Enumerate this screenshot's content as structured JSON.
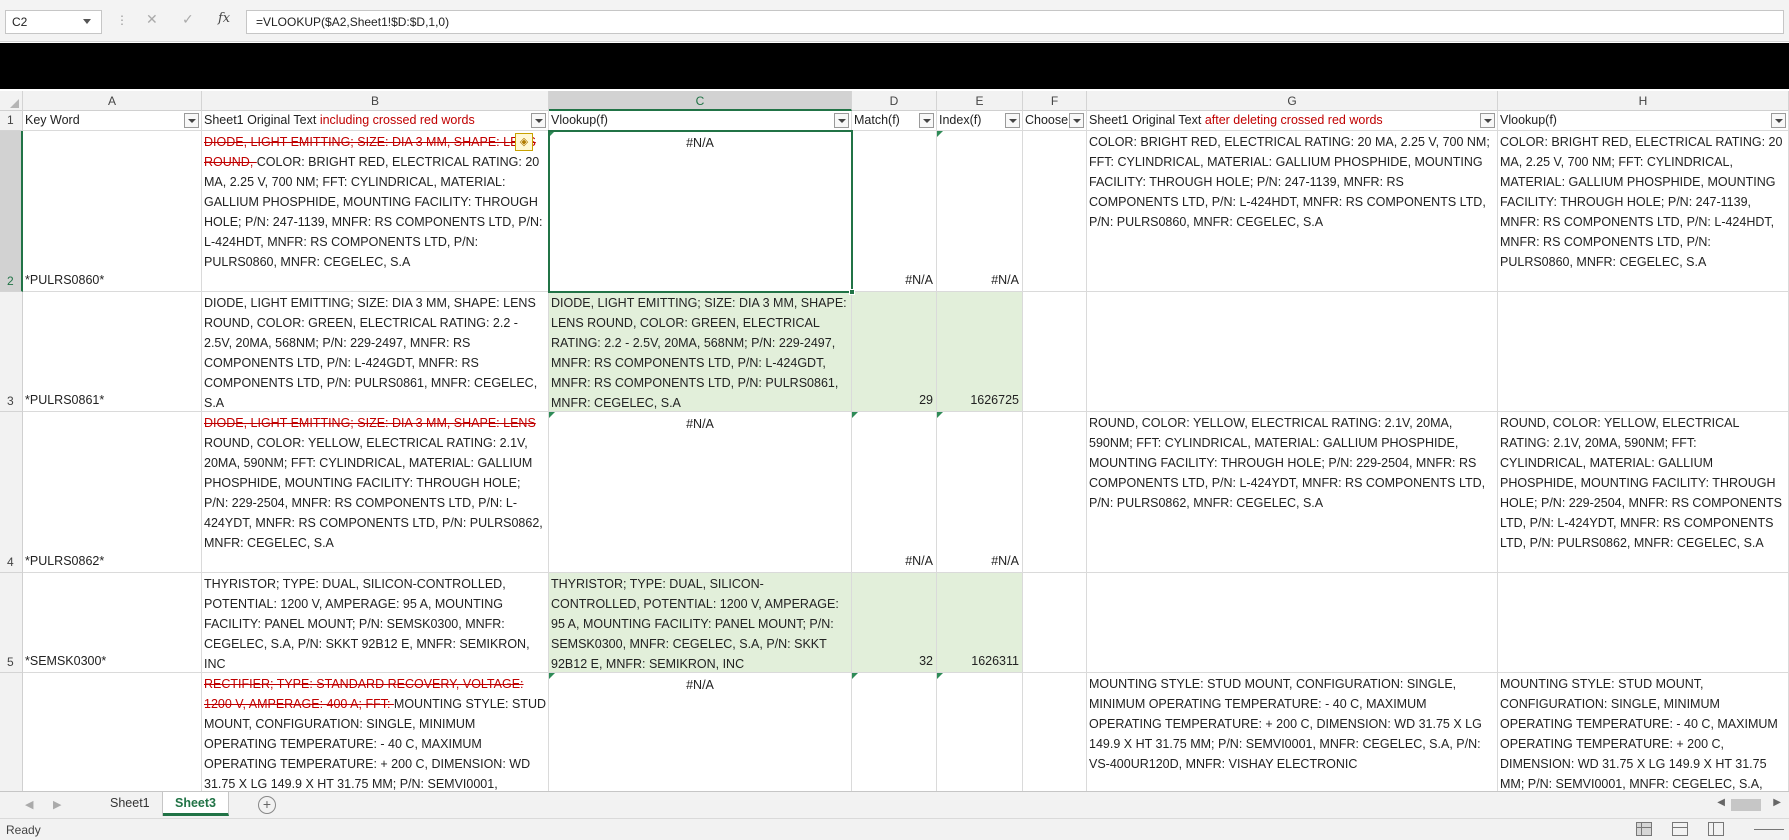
{
  "formula_bar": {
    "name_box": "C2",
    "cancel_glyph": "✕",
    "enter_glyph": "✓",
    "fx_label": "fx",
    "formula": "=VLOOKUP($A2,Sheet1!$D:$D,1,0)"
  },
  "columns": [
    "A",
    "B",
    "C",
    "D",
    "E",
    "F",
    "G",
    "H"
  ],
  "active_column": "C",
  "header_row": {
    "row_number": "1",
    "a": "Key Word",
    "b_plain": "Sheet1 Original Text ",
    "b_red": "including crossed red words",
    "c": "Vlookup(f)",
    "d": "Match(f)",
    "e": "Index(f)",
    "f": "Choose",
    "g_plain": "Sheet1 Original Text ",
    "g_red": "after deleting crossed red words",
    "h": "Vlookup(f)"
  },
  "rows": [
    {
      "row_number": "2",
      "a": "*PULRS0860*",
      "b_strike": "DIODE, LIGHT EMITTING; SIZE: DIA 3 MM, SHAPE: LENS ROUND, ",
      "b_text": "COLOR: BRIGHT RED, ELECTRICAL RATING: 20 MA, 2.25 V, 700 NM; FFT: CYLINDRICAL, MATERIAL: GALLIUM PHOSPHIDE, MOUNTING FACILITY: THROUGH HOLE; P/N: 247-1139, MNFR: RS COMPONENTS LTD, P/N: L-424HDT, MNFR: RS COMPONENTS LTD, P/N: PULRS0860, MNFR: CEGELEC, S.A",
      "c": "#N/A",
      "d": "#N/A",
      "e": "#N/A",
      "f": "",
      "g": "COLOR: BRIGHT RED, ELECTRICAL RATING: 20 MA, 2.25 V, 700 NM; FFT: CYLINDRICAL, MATERIAL: GALLIUM PHOSPHIDE, MOUNTING FACILITY: THROUGH HOLE; P/N: 247-1139, MNFR: RS COMPONENTS LTD, P/N: L-424HDT, MNFR: RS COMPONENTS LTD, P/N: PULRS0860, MNFR: CEGELEC, S.A",
      "h": "COLOR: BRIGHT RED, ELECTRICAL RATING: 20 MA, 2.25 V, 700 NM; FFT: CYLINDRICAL, MATERIAL: GALLIUM PHOSPHIDE, MOUNTING FACILITY: THROUGH HOLE; P/N: 247-1139, MNFR: RS COMPONENTS LTD, P/N: L-424HDT, MNFR: RS COMPONENTS LTD, P/N: PULRS0860, MNFR: CEGELEC, S.A"
    },
    {
      "row_number": "3",
      "a": "*PULRS0861*",
      "b_strike": "",
      "b_text": "DIODE, LIGHT EMITTING; SIZE: DIA 3 MM, SHAPE: LENS ROUND, COLOR: GREEN, ELECTRICAL RATING: 2.2 - 2.5V, 20MA, 568NM; P/N: 229-2497, MNFR: RS COMPONENTS LTD, P/N: L-424GDT, MNFR: RS COMPONENTS LTD, P/N: PULRS0861, MNFR: CEGELEC, S.A",
      "c": "DIODE, LIGHT EMITTING; SIZE: DIA 3 MM, SHAPE: LENS ROUND, COLOR: GREEN, ELECTRICAL RATING: 2.2 - 2.5V, 20MA, 568NM; P/N: 229-2497, MNFR: RS COMPONENTS LTD, P/N: L-424GDT, MNFR: RS COMPONENTS LTD, P/N: PULRS0861, MNFR: CEGELEC, S.A",
      "d": "29",
      "e": "1626725",
      "f": "",
      "g": "",
      "h": ""
    },
    {
      "row_number": "4",
      "a": "*PULRS0862*",
      "b_strike": "DIODE, LIGHT EMITTING; SIZE: DIA 3 MM, SHAPE: LENS ",
      "b_text": "ROUND, COLOR: YELLOW, ELECTRICAL RATING: 2.1V, 20MA,  590NM; FFT: CYLINDRICAL, MATERIAL: GALLIUM PHOSPHIDE, MOUNTING FACILITY: THROUGH HOLE; P/N: 229-2504, MNFR: RS COMPONENTS LTD, P/N: L-424YDT, MNFR: RS COMPONENTS LTD, P/N: PULRS0862, MNFR: CEGELEC, S.A",
      "c": "#N/A",
      "d": "#N/A",
      "e": "#N/A",
      "f": "",
      "g": "ROUND, COLOR: YELLOW, ELECTRICAL RATING: 2.1V, 20MA, 590NM; FFT: CYLINDRICAL, MATERIAL: GALLIUM PHOSPHIDE, MOUNTING FACILITY: THROUGH HOLE; P/N: 229-2504, MNFR: RS COMPONENTS LTD, P/N: L-424YDT, MNFR: RS COMPONENTS LTD, P/N: PULRS0862, MNFR: CEGELEC, S.A",
      "h": "ROUND, COLOR: YELLOW, ELECTRICAL RATING: 2.1V, 20MA,  590NM; FFT: CYLINDRICAL, MATERIAL: GALLIUM PHOSPHIDE, MOUNTING FACILITY: THROUGH HOLE; P/N: 229-2504, MNFR: RS COMPONENTS LTD, P/N: L-424YDT, MNFR: RS COMPONENTS LTD, P/N: PULRS0862, MNFR: CEGELEC, S.A"
    },
    {
      "row_number": "5",
      "a": "*SEMSK0300*",
      "b_strike": "",
      "b_text": "THYRISTOR; TYPE: DUAL, SILICON-CONTROLLED, POTENTIAL: 1200 V, AMPERAGE: 95 A, MOUNTING FACILITY: PANEL MOUNT; P/N: SEMSK0300, MNFR: CEGELEC, S.A, P/N: SKKT 92B12 E, MNFR: SEMIKRON, INC",
      "c": "THYRISTOR; TYPE: DUAL, SILICON-CONTROLLED, POTENTIAL: 1200 V, AMPERAGE: 95 A, MOUNTING FACILITY: PANEL MOUNT; P/N: SEMSK0300, MNFR: CEGELEC, S.A, P/N: SKKT 92B12 E, MNFR: SEMIKRON, INC",
      "d": "32",
      "e": "1626311",
      "f": "",
      "g": "",
      "h": ""
    },
    {
      "row_number": "6",
      "a": "",
      "b_strike": "RECTIFIER; TYPE: STANDARD RECOVERY, VOLTAGE: 1200 V, AMPERAGE: 400 A; FFT: ",
      "b_text": "MOUNTING STYLE: STUD MOUNT, CONFIGURATION: SINGLE, MINIMUM OPERATING TEMPERATURE: - 40 C, MAXIMUM OPERATING TEMPERATURE: + 200 C, DIMENSION: WD 31.75 X LG 149.9 X HT 31.75 MM; P/N: SEMVI0001,",
      "c": "#N/A",
      "d": "",
      "e": "",
      "f": "",
      "g": "MOUNTING STYLE: STUD MOUNT, CONFIGURATION: SINGLE, MINIMUM OPERATING TEMPERATURE: - 40 C, MAXIMUM OPERATING TEMPERATURE: + 200 C, DIMENSION: WD 31.75 X LG 149.9 X HT 31.75 MM; P/N: SEMVI0001, MNFR: CEGELEC, S.A, P/N: VS-400UR120D, MNFR: VISHAY ELECTRONIC",
      "h": "MOUNTING STYLE: STUD MOUNT, CONFIGURATION: SINGLE, MINIMUM OPERATING TEMPERATURE: - 40 C, MAXIMUM OPERATING TEMPERATURE: + 200 C, DIMENSION: WD 31.75 X LG 149.9 X HT 31.75 MM; P/N: SEMVI0001, MNFR: CEGELEC, S.A,"
    }
  ],
  "sheet_tabs": [
    "Sheet1",
    "Sheet3"
  ],
  "active_sheet": "Sheet3",
  "add_sheet_glyph": "+",
  "status": "Ready",
  "colors": {
    "accent": "#217346",
    "match_fill": "#e2efda",
    "strike_red": "#c00000"
  }
}
